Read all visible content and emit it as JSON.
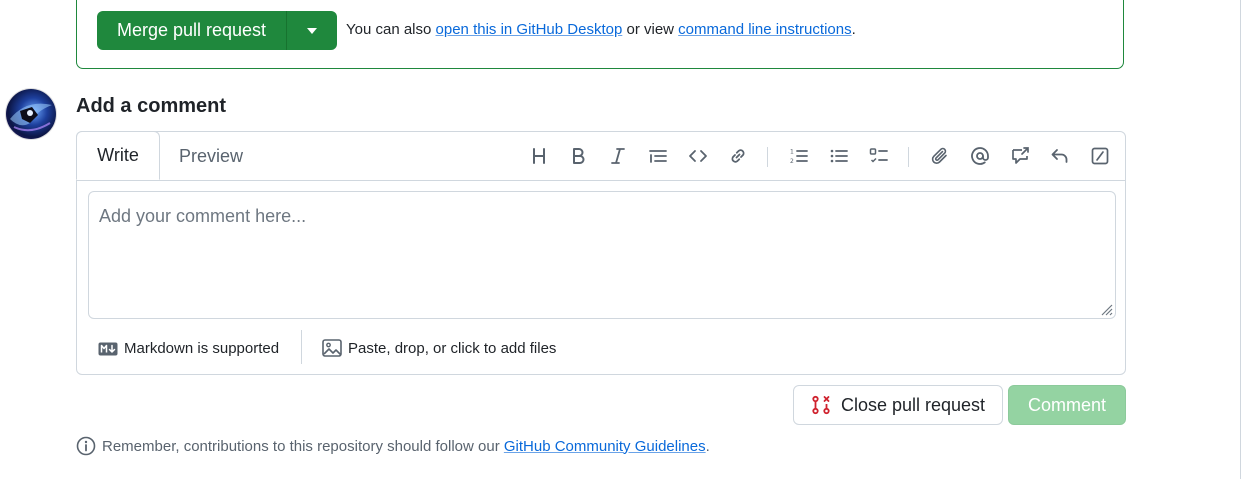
{
  "merge": {
    "button_label": "Merge pull request",
    "hint_prefix": "You can also ",
    "desktop_link": "open this in GitHub Desktop",
    "hint_middle": " or view ",
    "cli_link": "command line instructions",
    "hint_suffix": "."
  },
  "comment": {
    "title": "Add a comment",
    "tabs": {
      "write": "Write",
      "preview": "Preview"
    },
    "placeholder": "Add your comment here...",
    "markdown_note": "Markdown is supported",
    "attach_note": "Paste, drop, or click to add files"
  },
  "toolbar": {
    "icons": [
      "heading-icon",
      "bold-icon",
      "italic-icon",
      "quote-icon",
      "code-icon",
      "link-icon",
      "ordered-list-icon",
      "unordered-list-icon",
      "task-list-icon",
      "attach-icon",
      "mention-icon",
      "reference-icon",
      "reply-icon",
      "slash-command-icon"
    ]
  },
  "actions": {
    "close_label": "Close pull request",
    "comment_label": "Comment"
  },
  "footer": {
    "prefix": "Remember, contributions to this repository should follow our ",
    "link": "GitHub Community Guidelines",
    "suffix": "."
  },
  "colors": {
    "merge_green": "#1f883d",
    "comment_disabled": "#94d3a2",
    "link_blue": "#0969da",
    "close_red": "#cf222e"
  }
}
